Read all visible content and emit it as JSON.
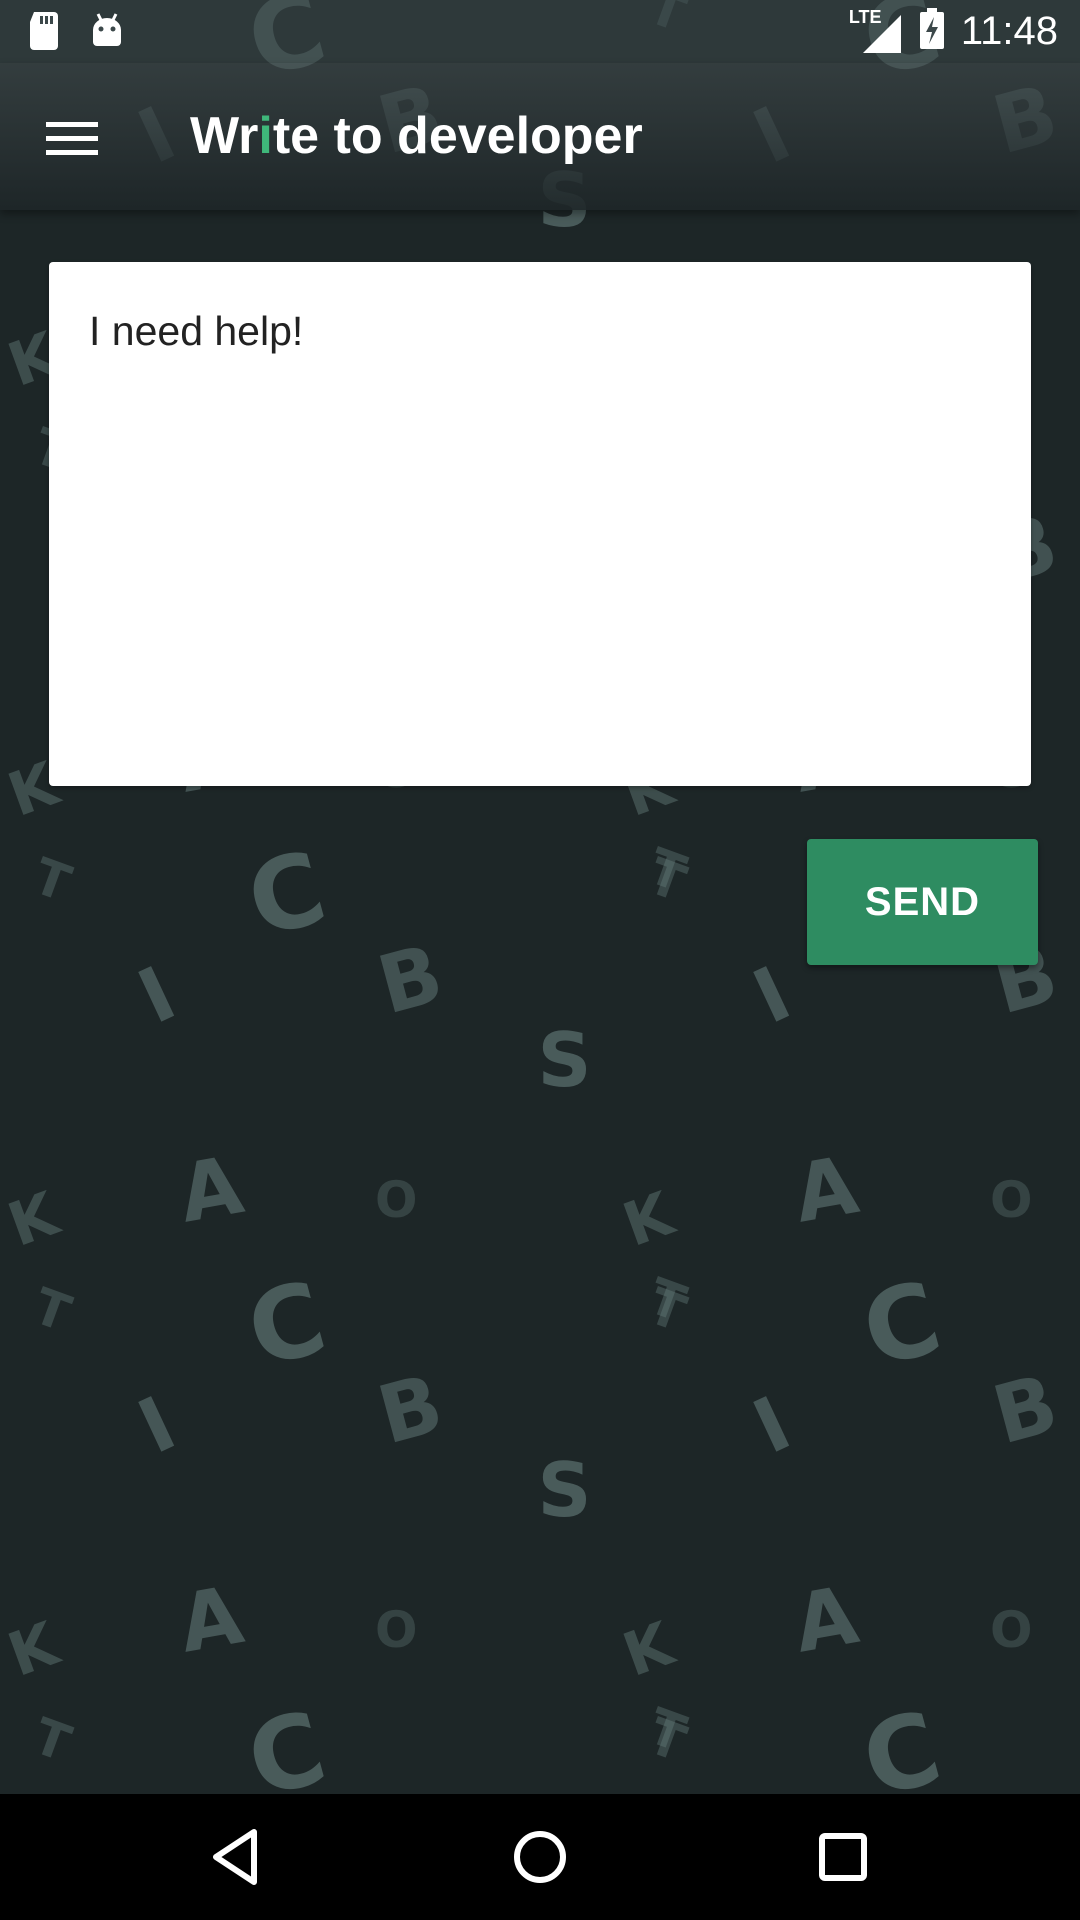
{
  "status_bar": {
    "time": "11:48",
    "network": "LTE",
    "icons": [
      "sd-card-icon",
      "android-icon",
      "signal-icon",
      "battery-charging-icon"
    ]
  },
  "toolbar": {
    "title_before": "Wr",
    "title_accent": "i",
    "title_after": "te to developer",
    "menu_icon": "hamburger-menu-icon"
  },
  "message": {
    "value": "I need help!"
  },
  "send_button": {
    "label": "SEND"
  },
  "nav_bar": {
    "icons": [
      "back-icon",
      "home-icon",
      "recents-icon"
    ]
  },
  "colors": {
    "background": "#1d2627",
    "accent": "#3fb77a",
    "button": "#2e8c61",
    "pattern_letter": "#6e8785"
  }
}
